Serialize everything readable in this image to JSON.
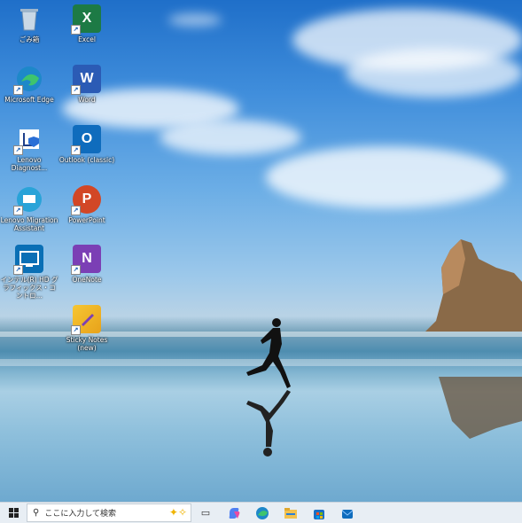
{
  "desktop": {
    "icons": [
      {
        "label": "ごみ箱",
        "icon": "recycle-bin-icon",
        "color": "#6d8fb0"
      },
      {
        "label": "Microsoft Edge",
        "icon": "edge-icon",
        "color": "#1e88c9"
      },
      {
        "label": "Lenovo Diagnost...",
        "icon": "lenovo-diagnostics-icon",
        "color": "#ffffff"
      },
      {
        "label": "Lenovo Migration Assistant",
        "icon": "lenovo-migration-icon",
        "color": "#29a3d8"
      },
      {
        "label": "インテル(R) HD グラフィックス・コントロ...",
        "icon": "intel-graphics-icon",
        "color": "#0a6fb5"
      },
      {
        "label": "Excel",
        "icon": "excel-icon",
        "color": "#1d7a45",
        "glyph": "X"
      },
      {
        "label": "Word",
        "icon": "word-icon",
        "color": "#2b5bb5",
        "glyph": "W"
      },
      {
        "label": "Outlook (classic)",
        "icon": "outlook-icon",
        "color": "#0f6cbd",
        "glyph": "O"
      },
      {
        "label": "PowerPoint",
        "icon": "powerpoint-icon",
        "color": "#d24726",
        "glyph": "P"
      },
      {
        "label": "OneNote",
        "icon": "onenote-icon",
        "color": "#7b3fb5",
        "glyph": "N"
      },
      {
        "label": "Sticky Notes (new)",
        "icon": "sticky-notes-icon",
        "color": "#f6c633"
      }
    ]
  },
  "taskbar": {
    "search_placeholder": "ここに入力して検索",
    "apps": [
      "task-view-icon",
      "copilot-icon",
      "edge-icon",
      "file-explorer-icon",
      "microsoft-store-icon",
      "outlook-icon"
    ]
  }
}
